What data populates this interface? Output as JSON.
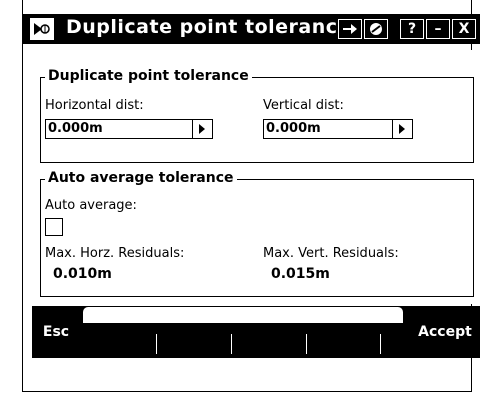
{
  "window": {
    "title": "Duplicate point tolerance",
    "icons": [
      "app-icon",
      "arrow-icon",
      "reset-icon"
    ],
    "help_label": "?",
    "minimize_label": "–",
    "close_label": "X"
  },
  "duplicate_group": {
    "legend": "Duplicate point tolerance",
    "horizontal_label": "Horizontal dist:",
    "horizontal_value": "0.000m",
    "vertical_label": "Vertical dist:",
    "vertical_value": "0.000m"
  },
  "auto_group": {
    "legend": "Auto average tolerance",
    "auto_average_label": "Auto average:",
    "auto_average_checked": false,
    "max_horz_label": "Max. Horz. Residuals:",
    "max_horz_value": "0.010m",
    "max_vert_label": "Max. Vert. Residuals:",
    "max_vert_value": "0.015m"
  },
  "softkeys": {
    "esc_label": "Esc",
    "accept_label": "Accept"
  },
  "colors": {
    "bar": "#000000",
    "background": "#ffffff"
  }
}
